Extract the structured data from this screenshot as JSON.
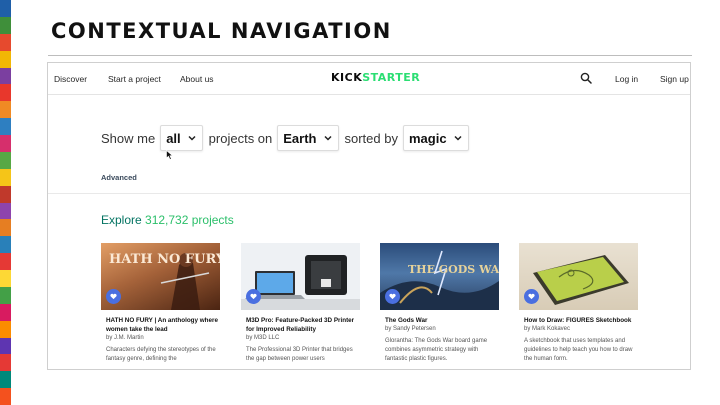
{
  "slide": {
    "title": "CONTEXTUAL NAVIGATION"
  },
  "nav": {
    "discover": "Discover",
    "start_project": "Start a project",
    "about": "About us",
    "logo_part1": "KICK",
    "logo_part2": "STARTER",
    "login": "Log in",
    "signup": "Sign up"
  },
  "filter": {
    "show_me": "Show me",
    "category_value": "all",
    "projects_on": "projects on",
    "location_value": "Earth",
    "sorted_by": "sorted by",
    "sort_value": "magic",
    "advanced": "Advanced"
  },
  "explore": {
    "lead": "Explore",
    "count": "312,732 projects"
  },
  "cards": [
    {
      "title": "HATH NO FURY | An anthology where women take the lead",
      "by": "by J.M. Martin",
      "desc": "Characters defying the stereotypes of the fantasy genre, defining the",
      "image_text": "HATH NO FURY"
    },
    {
      "title": "M3D Pro: Feature-Packed 3D Printer for Improved Reliability",
      "by": "by M3D LLC",
      "desc": "The Professional 3D Printer that bridges the gap between power users",
      "image_text": ""
    },
    {
      "title": "The Gods War",
      "by": "by Sandy Petersen",
      "desc": "Glorantha: The Gods War board game combines asymmetric strategy with fantastic plastic figures.",
      "image_text": "THE GODS WAR"
    },
    {
      "title": "How to Draw: FIGURES Sketchbook",
      "by": "by Mark Kokavec",
      "desc": "A sketchbook that uses templates and guidelines to help teach you how to draw the human form.",
      "image_text": ""
    }
  ],
  "colors": {
    "accent_green": "#2bde73",
    "explore_teal": "#037362",
    "heart_blue": "#4a6fe0"
  },
  "icons": [
    "search-icon",
    "chevron-down-icon",
    "heart-icon",
    "cursor-icon"
  ]
}
